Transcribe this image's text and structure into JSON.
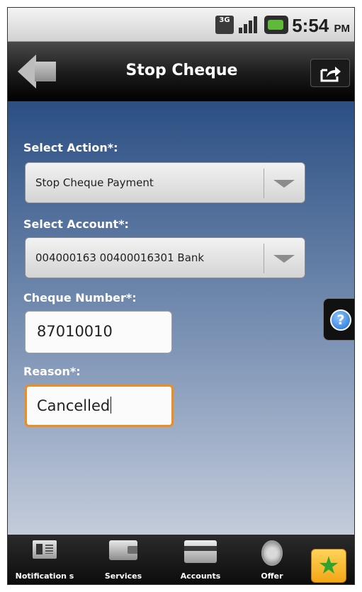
{
  "status_bar": {
    "network": "3G",
    "time": "5:54",
    "ampm": "PM"
  },
  "header": {
    "title": "Stop Cheque"
  },
  "form": {
    "action_label": "Select Action*:",
    "action_value": "Stop Cheque Payment",
    "account_label": "Select Account*:",
    "account_value": "004000163 00400016301 Bank",
    "cheque_label": "Cheque Number*:",
    "cheque_value": "87010010",
    "reason_label": "Reason*:",
    "reason_value": "Cancelled"
  },
  "help": {
    "symbol": "?"
  },
  "tabbar": {
    "tabs": [
      {
        "label": "Notification s",
        "icon": "notification-card-icon"
      },
      {
        "label": "Services",
        "icon": "wallet-icon"
      },
      {
        "label": "Accounts",
        "icon": "credit-card-icon"
      },
      {
        "label": "Offer",
        "icon": "gear-icon"
      }
    ],
    "favorite_icon": "star-icon"
  },
  "colors": {
    "content_top": "#2b4f83",
    "content_bottom": "#c4ccdb",
    "focus": "#f08c1c",
    "favorite": "#f2a716"
  }
}
